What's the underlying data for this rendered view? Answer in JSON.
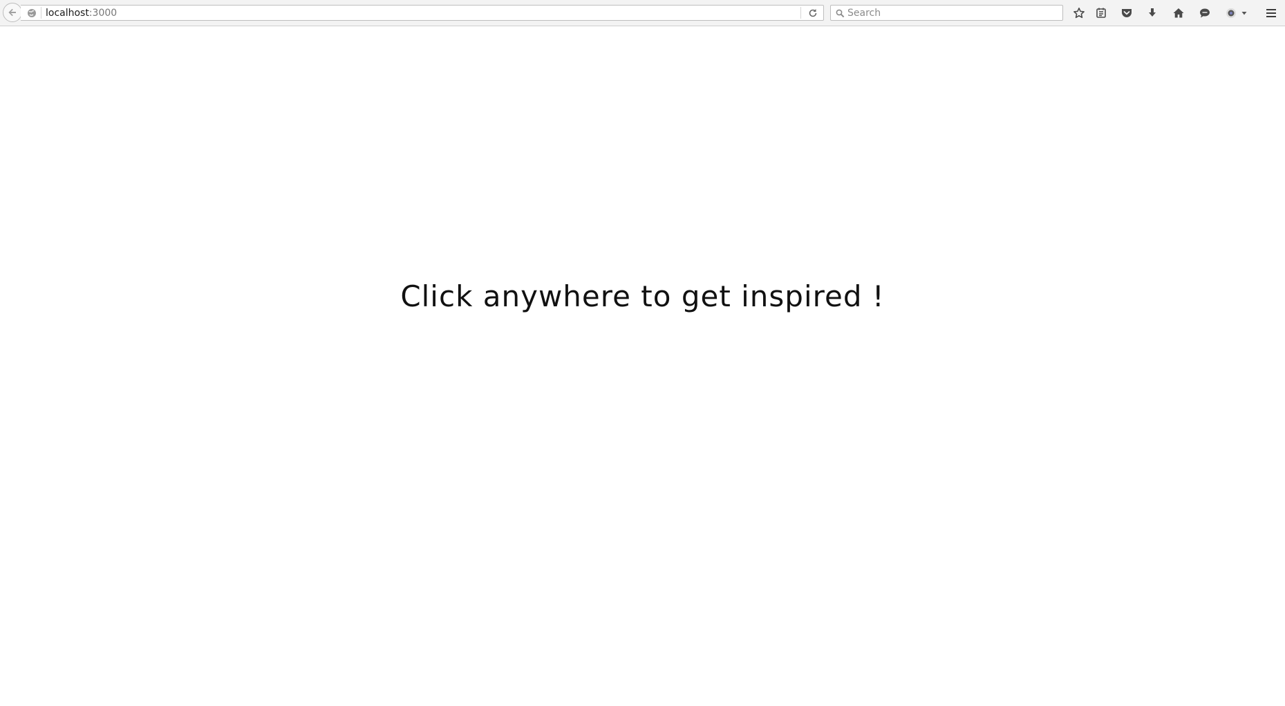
{
  "browser": {
    "url_host": "localhost",
    "url_port": ":3000",
    "search": {
      "placeholder": "Search"
    },
    "toolbar_icons": [
      "bookmark-star-icon",
      "reading-list-icon",
      "pocket-icon",
      "downloads-icon",
      "home-icon",
      "chat-icon",
      "extension-icon",
      "hamburger-menu-icon"
    ]
  },
  "page": {
    "headline": "Click anywhere to get inspired !"
  }
}
